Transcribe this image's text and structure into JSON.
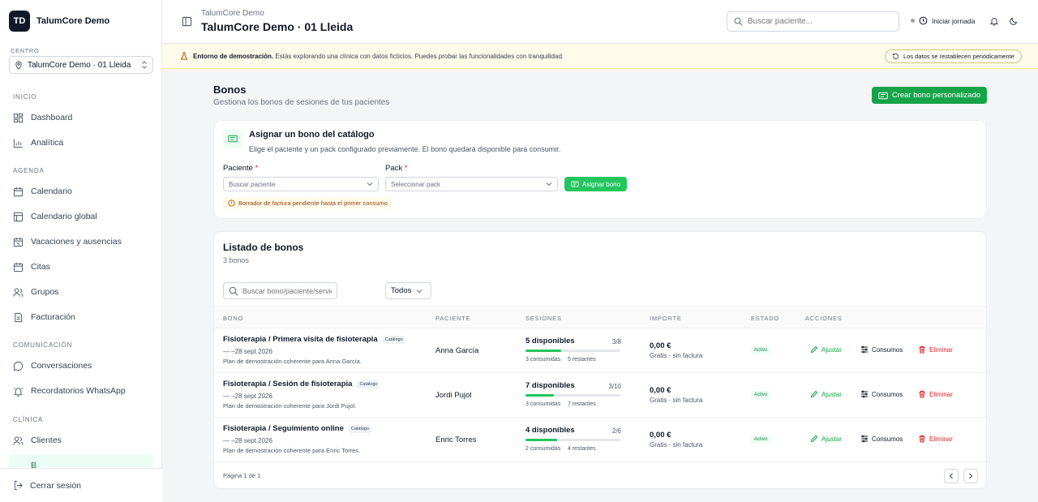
{
  "sidebar": {
    "logo_initials": "TD",
    "brand_name": "TalumCore Demo",
    "center_label": "CENTRO",
    "center_value": "TalumCore Demo · 01 Lleida",
    "sections": {
      "inicio": "INICIO",
      "agenda": "AGENDA",
      "comunicacion": "COMUNICACIÓN",
      "clinica": "CLÍNICA"
    },
    "items": {
      "dashboard": "Dashboard",
      "analitica": "Analítica",
      "calendario": "Calendario",
      "calendario_global": "Calendario global",
      "vacaciones": "Vacaciones y ausencias",
      "citas": "Citas",
      "grupos": "Grupos",
      "facturacion": "Facturación",
      "conversaciones": "Conversaciones",
      "recordatorios": "Recordatorios WhatsApp",
      "clientes": "Clientes",
      "bonos_partial": "B"
    },
    "logout": "Cerrar sesión"
  },
  "header": {
    "subtitle": "TalumCore Demo",
    "title": "TalumCore Demo · 01 Lleida",
    "search_placeholder": "Buscar paciente...",
    "start_day": "Iniciar jornada"
  },
  "banner": {
    "bold": "Entorno de demostración.",
    "text": " Estás explorando una clínica con datos ficticios. Puedes probar las funcionalidades con tranquilidad.",
    "reset": "Los datos se restablecen periódicamente"
  },
  "page": {
    "title": "Bonos",
    "subtitle": "Gestiona los bonos de sesiones de tus pacientes",
    "create_button": "Crear bono personalizado"
  },
  "assign": {
    "title": "Asignar un bono del catálogo",
    "description": "Elige el paciente y un pack configurado previamente. El bono quedará disponible para consumir.",
    "patient_label": "Paciente",
    "patient_placeholder": "Buscar paciente",
    "pack_label": "Pack",
    "pack_placeholder": "Seleccionar pack",
    "required_mark": "*",
    "button": "Asignar bono",
    "warning": "Borrador de factura pendiente hasta el primer consumo"
  },
  "list": {
    "title": "Listado de bonos",
    "count": "3 bonos",
    "search_placeholder": "Buscar bono/paciente/servicio",
    "filter": "Todos",
    "columns": {
      "bono": "BONO",
      "paciente": "PACIENTE",
      "sesiones": "SESIONES",
      "importe": "IMPORTE",
      "estado": "ESTADO",
      "acciones": "ACCIONES"
    },
    "rows": [
      {
        "title": "Fisioterapia / Primera visita de fisioterapia",
        "badge": "Catálogo",
        "date": "— –28 sept 2026",
        "plan": "Plan de demostración coherente para Anna García.",
        "patient": "Anna García",
        "available": "5 disponibles",
        "ratio": "3/8",
        "progress": 0.375,
        "used": "3 consumidas",
        "remaining": "5 restantes",
        "amount": "0,00 €",
        "amount_sub": "Gratis · sin factura",
        "status": "Activo"
      },
      {
        "title": "Fisioterapia / Sesión de fisioterapia",
        "badge": "Catálogo",
        "date": "— –28 sept 2026",
        "plan": "Plan de demostración coherente para Jordi Pujol.",
        "patient": "Jordi Pujol",
        "available": "7 disponibles",
        "ratio": "3/10",
        "progress": 0.3,
        "used": "3 consumidas",
        "remaining": "7 restantes",
        "amount": "0,00 €",
        "amount_sub": "Gratis · sin factura",
        "status": "Activo"
      },
      {
        "title": "Fisioterapia / Seguimiento online",
        "badge": "Catálogo",
        "date": "— –28 sept 2026",
        "plan": "Plan de demostración coherente para Enric Torres.",
        "patient": "Enric Torres",
        "available": "4 disponibles",
        "ratio": "2/6",
        "progress": 0.333,
        "used": "2 consumidas",
        "remaining": "4 restantes",
        "amount": "0,00 €",
        "amount_sub": "Gratis · sin factura",
        "status": "Activo"
      }
    ],
    "actions": {
      "adjust": "Ajustar",
      "consumos": "Consumos",
      "delete": "Eliminar"
    },
    "pagination": "Página 1 de 1"
  },
  "colors": {
    "accent": "#16a34a",
    "danger": "#dc2626",
    "warning_bg": "#fffbeb"
  }
}
